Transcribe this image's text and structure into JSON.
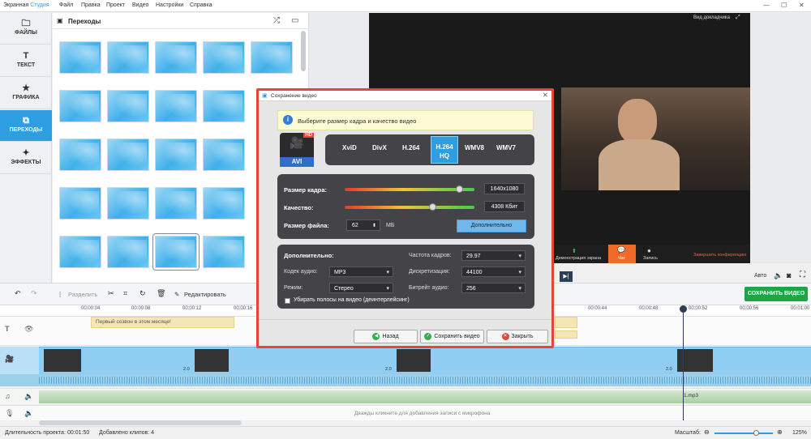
{
  "app": {
    "title_part1": "Экранная ",
    "title_part2": "Студия"
  },
  "menu": [
    "Файл",
    "Правка",
    "Проект",
    "Видео",
    "Настройки",
    "Справка"
  ],
  "sidebar": {
    "items": [
      {
        "label": "ФАЙЛЫ",
        "icon": "folder-icon"
      },
      {
        "label": "ТЕКСТ",
        "icon": "text-icon"
      },
      {
        "label": "ГРАФИКА",
        "icon": "star-icon"
      },
      {
        "label": "ПЕРЕХОДЫ",
        "icon": "transitions-icon",
        "active": true
      },
      {
        "label": "ЭФФЕКТЫ",
        "icon": "wand-icon"
      }
    ]
  },
  "transitions": {
    "title": "Переходы"
  },
  "preview": {
    "speaker_view": "Вид докладчика",
    "share_screen": "Демонстрация экрана",
    "chat": "Чат",
    "record": "Запись",
    "end_conference": "Завершить конференцию"
  },
  "toolbar": {
    "split": "Разделить",
    "edit": "Редактировать",
    "save_video": "СОХРАНИТЬ ВИДЕО",
    "auto": "Авто"
  },
  "ruler": [
    "00:00:04",
    "00:00:08",
    "00:00:12",
    "00:00:16",
    "00:00:44",
    "00:00:48",
    "00:00:52",
    "00:00:56",
    "00:01:00"
  ],
  "timeline": {
    "text_clip": "Первый созвон в этом месяце!",
    "clip_duration": "2.0",
    "audio_file": "1.mp3",
    "mic_hint": "Дважды кликните для добавления записи с микрофона"
  },
  "status": {
    "duration_label": "Длительность проекта:",
    "duration": "00:01:50",
    "clips": "Добавлено клипов: 4",
    "scale_label": "Масштаб:",
    "zoom": "125%"
  },
  "dialog": {
    "title": "Сохранение видео",
    "info": "Выберите размер кадра и качество видео",
    "badge": "AVI",
    "hd": "HD",
    "formats": [
      "XviD",
      "DivX",
      "H.264",
      "H.264 HQ",
      "WMV8",
      "WMV7"
    ],
    "selected_format": "H.264 HQ",
    "frame_size_label": "Размер кадра:",
    "frame_size": "1640x1080",
    "quality_label": "Качество:",
    "quality": "4308 Кбит",
    "file_size_label": "Размер файла:",
    "file_size": "62",
    "file_size_unit": "МБ",
    "more_button": "Дополнительно",
    "advanced_title": "Дополнительно:",
    "audio_codec_label": "Кодек аудио:",
    "audio_codec": "MP3",
    "mode_label": "Режим:",
    "mode": "Стерео",
    "fps_label": "Частота кадров:",
    "fps": "29.97",
    "sampling_label": "Дискретизация:",
    "sampling": "44100",
    "bitrate_label": "Битрейт аудио:",
    "bitrate": "256",
    "deinterlace": "Убирать полосы на видео (деинтерлейсинг)",
    "back": "Назад",
    "save": "Сохранить видео",
    "close": "Закрыть"
  },
  "colors": {
    "accent": "#2f9ee0",
    "save": "#1ea545",
    "dialog_border": "#e0463a"
  }
}
